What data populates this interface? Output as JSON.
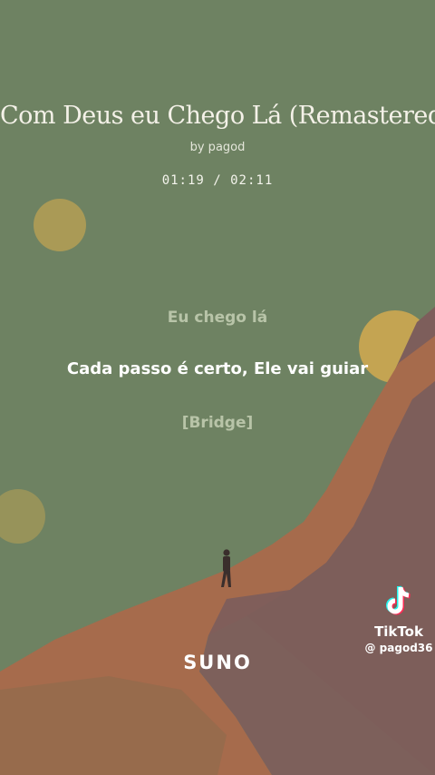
{
  "song": {
    "title": "Com Deus eu Chego Lá (Remastered)",
    "artist": "by pagod",
    "time": "01:19 / 02:11"
  },
  "lyrics": {
    "previous": "Eu chego lá",
    "current": "Cada passo é certo, Ele vai guiar",
    "next": "[Bridge]"
  },
  "branding": {
    "suno": "SUNO",
    "tiktok_name": "TikTok",
    "tiktok_handle": "@ pagod36"
  },
  "colors": {
    "sky": "#6e8262",
    "mountain_front": "#a66b4c",
    "mountain_back": "#7d5e5b",
    "sun": "#c4a452"
  },
  "icons": [
    "tiktok-logo-icon",
    "sun-icon",
    "walking-figure-icon"
  ]
}
